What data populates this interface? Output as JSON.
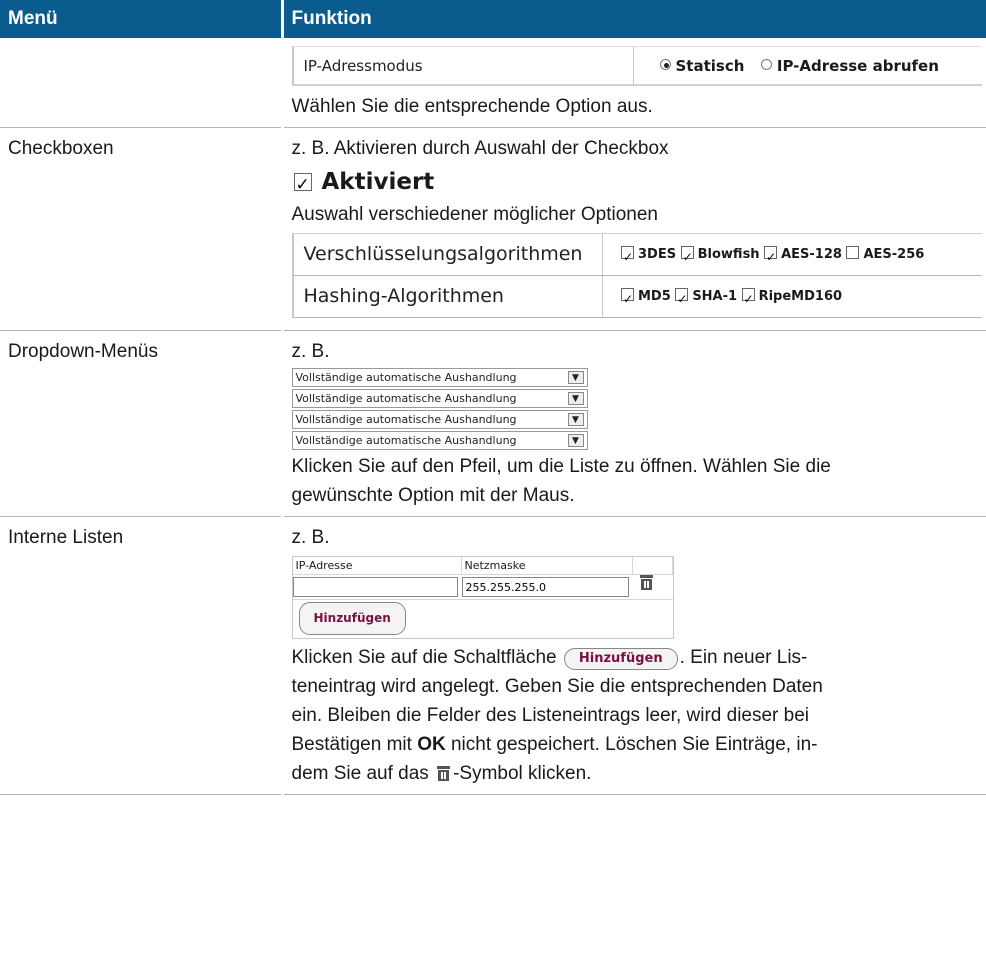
{
  "header": {
    "col_menu": "Menü",
    "col_function": "Funktion"
  },
  "row_radio": {
    "setting_label": "IP-Adressmodus",
    "option_static": "Statisch",
    "option_fetch": "IP-Adresse abrufen",
    "selected": "Statisch",
    "description": "Wählen Sie die entsprechende Option aus."
  },
  "row_checkbox": {
    "menu": "Checkboxen",
    "intro": "z. B. Aktivieren durch Auswahl der Checkbox",
    "big_checkbox_label": "Aktiviert",
    "intro2": "Auswahl verschiedener möglicher Optionen",
    "encryption_label": "Verschlüsselungsalgorithmen",
    "encryption_options": [
      {
        "label": "3DES",
        "checked": true
      },
      {
        "label": "Blowfish",
        "checked": true
      },
      {
        "label": "AES-128",
        "checked": true
      },
      {
        "label": "AES-256",
        "checked": false
      }
    ],
    "hashing_label": "Hashing-Algorithmen",
    "hashing_options": [
      {
        "label": "MD5",
        "checked": true
      },
      {
        "label": "SHA-1",
        "checked": true
      },
      {
        "label": "RipeMD160",
        "checked": true
      }
    ]
  },
  "row_dropdown": {
    "menu": "Dropdown-Menüs",
    "intro": "z. B.",
    "dropdowns": [
      "Vollständige automatische Aushandlung",
      "Vollständige automatische Aushandlung",
      "Vollständige automatische Aushandlung",
      "Vollständige automatische Aushandlung"
    ],
    "description_line1": "Klicken Sie auf den Pfeil, um die Liste zu öffnen. Wählen Sie die",
    "description_line2": "gewünschte Option mit der Maus."
  },
  "row_list": {
    "menu": "Interne Listen",
    "intro": "z. B.",
    "col_ip": "IP-Adresse",
    "col_mask": "Netzmaske",
    "ip_value": "",
    "mask_value": "255.255.255.0",
    "add_button": "Hinzufügen",
    "text_before_button": "Klicken Sie auf die Schaltfläche",
    "text_after_button": ". Ein neuer Lis-",
    "line2": "teneintrag wird angelegt. Geben Sie die entsprechenden Daten",
    "line3": "ein. Bleiben die Felder des Listeneintrags leer, wird dieser bei",
    "line4_pre": "Bestätigen mit",
    "line4_bold": "OK",
    "line4_post": "nicht gespeichert. Löschen Sie Einträge, in-",
    "line5_pre": "dem Sie auf das",
    "line5_post": "-Symbol klicken."
  },
  "icons": {
    "trash": "trash-icon",
    "checkbox": "checkbox-icon",
    "radio": "radio-icon",
    "dropdown_arrow": "chevron-down-icon"
  },
  "colors": {
    "header_bg": "#0a5c8f",
    "header_text": "#ffffff",
    "button_text": "#7a1040"
  }
}
